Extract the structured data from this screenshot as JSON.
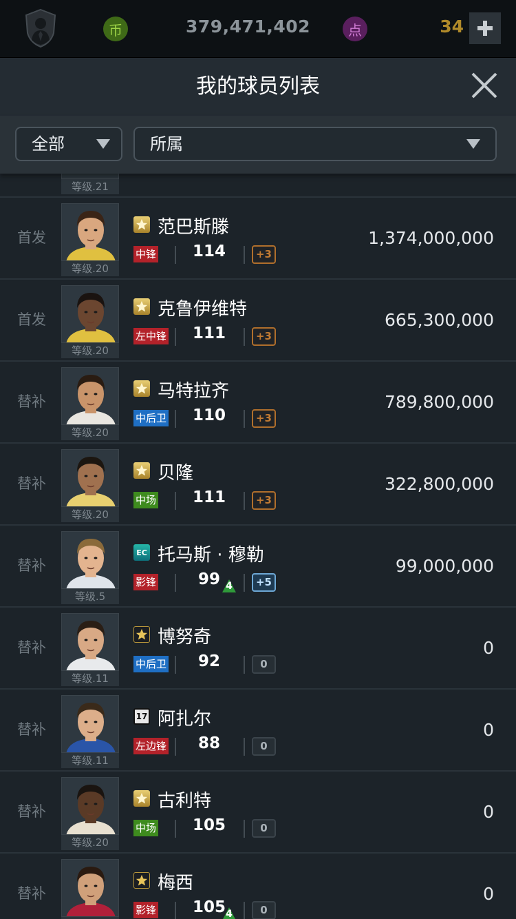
{
  "topbar": {
    "shield_icon": "manager-shield-icon",
    "coin_label": "币",
    "coins": "379,471,402",
    "point_label": "点",
    "points": "34",
    "plus_icon": "plus-icon"
  },
  "header": {
    "title": "我的球员列表",
    "close_icon": "close-icon"
  },
  "filters": {
    "category": "全部",
    "club": "所属"
  },
  "partial_row": {
    "level": "等级.21"
  },
  "players": [
    {
      "role": "首发",
      "level": "等级.20",
      "season": "gold-star",
      "name": "范巴斯滕",
      "position": "中锋",
      "pos_color": "red",
      "ovr": "114",
      "upgrade": "+3",
      "upgrade_style": "bronze",
      "price": "1,374,000,000"
    },
    {
      "role": "首发",
      "level": "等级.20",
      "season": "gold-star",
      "name": "克鲁伊维特",
      "position": "左中锋",
      "pos_color": "red",
      "ovr": "111",
      "upgrade": "+3",
      "upgrade_style": "bronze",
      "price": "665,300,000"
    },
    {
      "role": "替补",
      "level": "等级.20",
      "season": "gold-star",
      "name": "马特拉齐",
      "position": "中后卫",
      "pos_color": "blue",
      "ovr": "110",
      "upgrade": "+3",
      "upgrade_style": "bronze",
      "price": "789,800,000"
    },
    {
      "role": "替补",
      "level": "等级.20",
      "season": "gold-star",
      "name": "贝隆",
      "position": "中场",
      "pos_color": "green",
      "ovr": "111",
      "upgrade": "+3",
      "upgrade_style": "bronze",
      "price": "322,800,000"
    },
    {
      "role": "替补",
      "level": "等级.5",
      "season": "EC",
      "name": "托马斯 · 穆勒",
      "position": "影锋",
      "pos_color": "red",
      "ovr": "99",
      "train": "4",
      "upgrade": "+5",
      "upgrade_style": "silver",
      "price": "99,000,000"
    },
    {
      "role": "替补",
      "level": "等级.11",
      "season": "dark-star",
      "name": "博努奇",
      "position": "中后卫",
      "pos_color": "blue",
      "ovr": "92",
      "upgrade": "0",
      "upgrade_style": "zero",
      "price": "0"
    },
    {
      "role": "替补",
      "level": "等级.11",
      "season": "17",
      "name": "阿扎尔",
      "position": "左边锋",
      "pos_color": "red",
      "ovr": "88",
      "upgrade": "0",
      "upgrade_style": "zero",
      "price": "0"
    },
    {
      "role": "替补",
      "level": "等级.20",
      "season": "gold-star",
      "name": "古利特",
      "position": "中场",
      "pos_color": "green",
      "ovr": "105",
      "upgrade": "0",
      "upgrade_style": "zero",
      "price": "0"
    },
    {
      "role": "替补",
      "level": "",
      "season": "dark-star",
      "name": "梅西",
      "position": "影锋",
      "pos_color": "red",
      "ovr": "105",
      "train": "4",
      "upgrade": "0",
      "upgrade_style": "zero",
      "price": "0"
    }
  ],
  "colors": {
    "background": "#1a2128",
    "position_red": "#b3222a",
    "position_blue": "#1f6fc4",
    "position_green": "#3e8b1e",
    "upgrade_bronze": "#b06f2c",
    "upgrade_silver": "#6ea8d6",
    "train_green": "#2f9a3a"
  }
}
